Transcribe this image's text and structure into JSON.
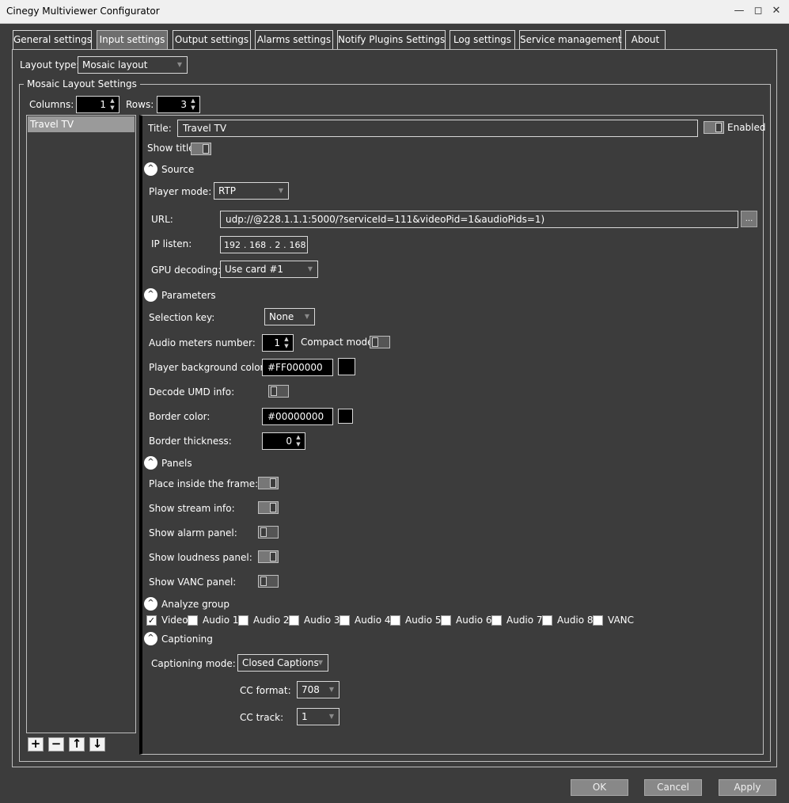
{
  "window": {
    "title": "Cinegy Multiviewer Configurator",
    "minimize_glyph": "—",
    "restore_glyph": "◻",
    "close_glyph": "✕"
  },
  "tabs": [
    {
      "label": "General settings"
    },
    {
      "label": "Input settings"
    },
    {
      "label": "Output settings"
    },
    {
      "label": "Alarms settings"
    },
    {
      "label": "Notify Plugins Settings"
    },
    {
      "label": "Log settings"
    },
    {
      "label": "Service management"
    },
    {
      "label": "About"
    }
  ],
  "active_tab": "Input settings",
  "layout": {
    "type_label": "Layout type:",
    "type_value": "Mosaic layout",
    "group_title": "Mosaic Layout Settings",
    "columns_label": "Columns:",
    "columns_value": "1",
    "rows_label": "Rows:",
    "rows_value": "3"
  },
  "sources_list": {
    "items": [
      "Travel TV"
    ],
    "selected": "Travel TV",
    "buttons": [
      "+",
      "−",
      "↑",
      "↓"
    ]
  },
  "detail": {
    "title_label": "Title:",
    "title_value": "Travel TV",
    "enabled_label": "Enabled",
    "enabled": true,
    "show_title_label": "Show title",
    "show_title": true,
    "source": {
      "header": "Source",
      "player_mode_label": "Player mode:",
      "player_mode_value": "RTP",
      "url_label": "URL:",
      "url_value": "udp://@228.1.1.1:5000/?serviceId=111&videoPid=1&audioPids=1)",
      "browse_label": "...",
      "ip_label": "IP listen:",
      "ip_octets": [
        "192",
        "168",
        "2",
        "168"
      ],
      "gpu_label": "GPU decoding:",
      "gpu_value": "Use card #1"
    },
    "parameters": {
      "header": "Parameters",
      "selection_key_label": "Selection key:",
      "selection_key_value": "None",
      "audio_meters_label": "Audio meters number:",
      "audio_meters_value": "1",
      "compact_mode_label": "Compact mode",
      "compact_mode": false,
      "player_bg_label": "Player background color:",
      "player_bg_value": "#FF000000",
      "player_bg_color": "#000000",
      "decode_umd_label": "Decode UMD info:",
      "decode_umd": false,
      "border_color_label": "Border color:",
      "border_color_value": "#00000000",
      "border_color_swatch": "#000000",
      "border_thickness_label": "Border thickness:",
      "border_thickness_value": "0"
    },
    "panels": {
      "header": "Panels",
      "place_inside_label": "Place inside the frame:",
      "place_inside": true,
      "show_stream_label": "Show stream info:",
      "show_stream": true,
      "show_alarm_label": "Show alarm panel:",
      "show_alarm": false,
      "show_loudness_label": "Show loudness panel:",
      "show_loudness": true,
      "show_vanc_label": "Show VANC panel:",
      "show_vanc": false
    },
    "analyze": {
      "header": "Analyze group",
      "items": [
        {
          "label": "Video",
          "checked": true
        },
        {
          "label": "Audio 1",
          "checked": false
        },
        {
          "label": "Audio 2",
          "checked": false
        },
        {
          "label": "Audio 3",
          "checked": false
        },
        {
          "label": "Audio 4",
          "checked": false
        },
        {
          "label": "Audio 5",
          "checked": false
        },
        {
          "label": "Audio 6",
          "checked": false
        },
        {
          "label": "Audio 7",
          "checked": false
        },
        {
          "label": "Audio 8",
          "checked": false
        },
        {
          "label": "VANC",
          "checked": false
        }
      ]
    },
    "captioning": {
      "header": "Captioning",
      "mode_label": "Captioning mode:",
      "mode_value": "Closed Captions",
      "cc_format_label": "CC format:",
      "cc_format_value": "708",
      "cc_track_label": "CC track:",
      "cc_track_value": "1"
    }
  },
  "footer": {
    "ok_label": "OK",
    "cancel_label": "Cancel",
    "apply_label": "Apply"
  },
  "icons": {
    "collapse": "^",
    "check": "✓",
    "spin_up": "▲",
    "spin_down": "▼",
    "dropdown": "▼"
  }
}
